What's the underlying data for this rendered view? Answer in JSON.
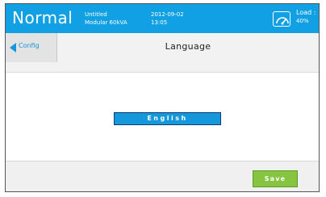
{
  "status_bar": {
    "mode": "Normal",
    "name_line1": "Untitled",
    "name_line2": "Modular 60kVA",
    "date": "2012-09-02",
    "time": "13:05",
    "load_label": "Load :",
    "load_value": "40%",
    "load_icon": "gauge-icon"
  },
  "nav": {
    "back_label": "Config",
    "title": "Language"
  },
  "languages": {
    "selected": "English"
  },
  "footer": {
    "save_label": "Save"
  },
  "colors": {
    "topbar": "#11a0e4",
    "accent": "#1597dc",
    "save": "#86c442"
  }
}
